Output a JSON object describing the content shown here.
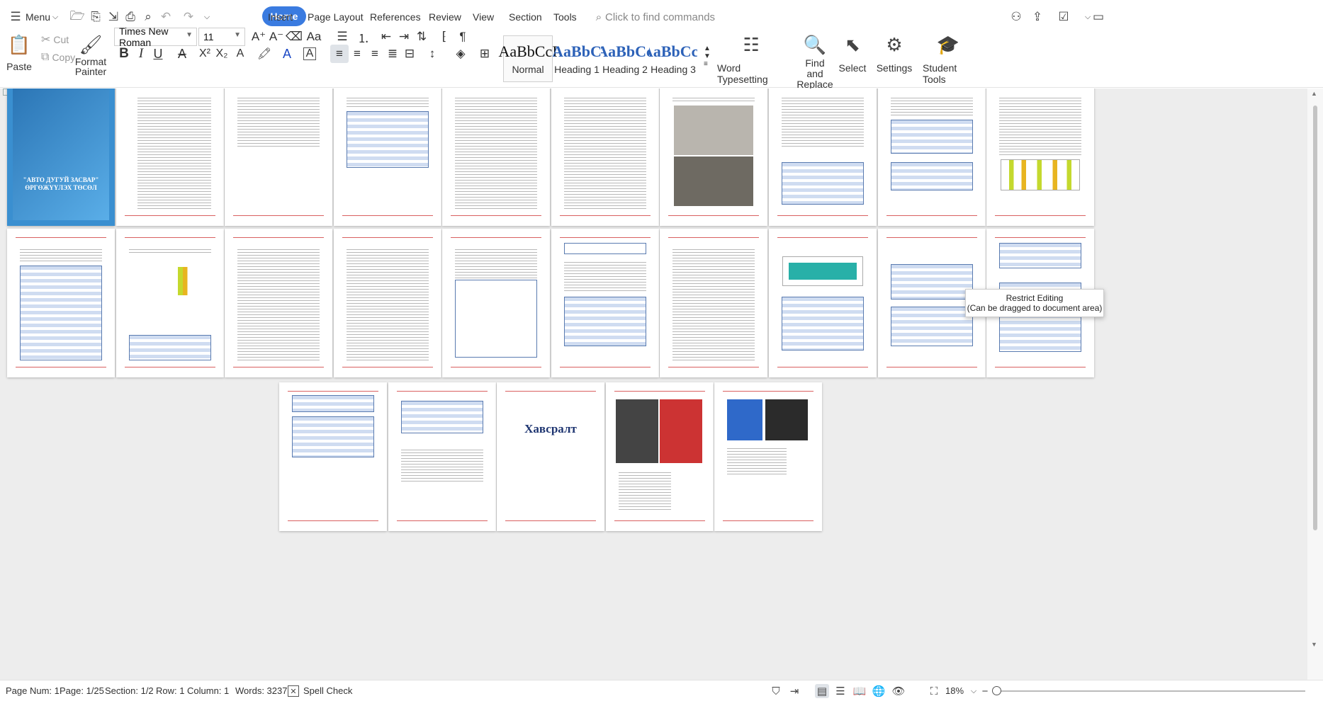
{
  "menubar": {
    "menu_label": "Menu",
    "tabs": [
      {
        "label": "Home"
      },
      {
        "label": "Insert"
      },
      {
        "label": "Page Layout"
      },
      {
        "label": "References"
      },
      {
        "label": "Review"
      },
      {
        "label": "View"
      },
      {
        "label": "Section"
      },
      {
        "label": "Tools"
      }
    ],
    "search_placeholder": "Click to find commands"
  },
  "ribbon": {
    "paste": "Paste",
    "cut": "Cut",
    "copy": "Copy",
    "format_painter_1": "Format",
    "format_painter_2": "Painter",
    "font_name": "Times New Roman",
    "font_size": "11",
    "styles": [
      {
        "preview": "AaBbCcI",
        "name": "Normal"
      },
      {
        "preview": "AaBbC",
        "name": "Heading 1"
      },
      {
        "preview": "AaBbCc",
        "name": "Heading 2"
      },
      {
        "preview": "AaBbCcI",
        "name": "Heading 3"
      }
    ],
    "word_typesetting": "Word Typesetting",
    "find_replace_1": "Find and",
    "find_replace_2": "Replace",
    "select": "Select",
    "settings": "Settings",
    "student_tools": "Student Tools"
  },
  "document": {
    "cover_title": "\"АВТО ДУГУЙ ЗАСВАР\" ӨРГӨЖҮҮЛЭХ ТӨСӨЛ",
    "appendix_title": "Хавсралт",
    "tooltip_line1": "Restrict Editing",
    "tooltip_line2": "(Can be dragged to document area)"
  },
  "status": {
    "page_num": "Page Num: 1",
    "page": "Page: 1/25",
    "section": "Section: 1/2",
    "row": "Row: 1",
    "column": "Column: 1",
    "words": "Words: 3237",
    "spell_check": "Spell Check",
    "zoom": "18%"
  }
}
